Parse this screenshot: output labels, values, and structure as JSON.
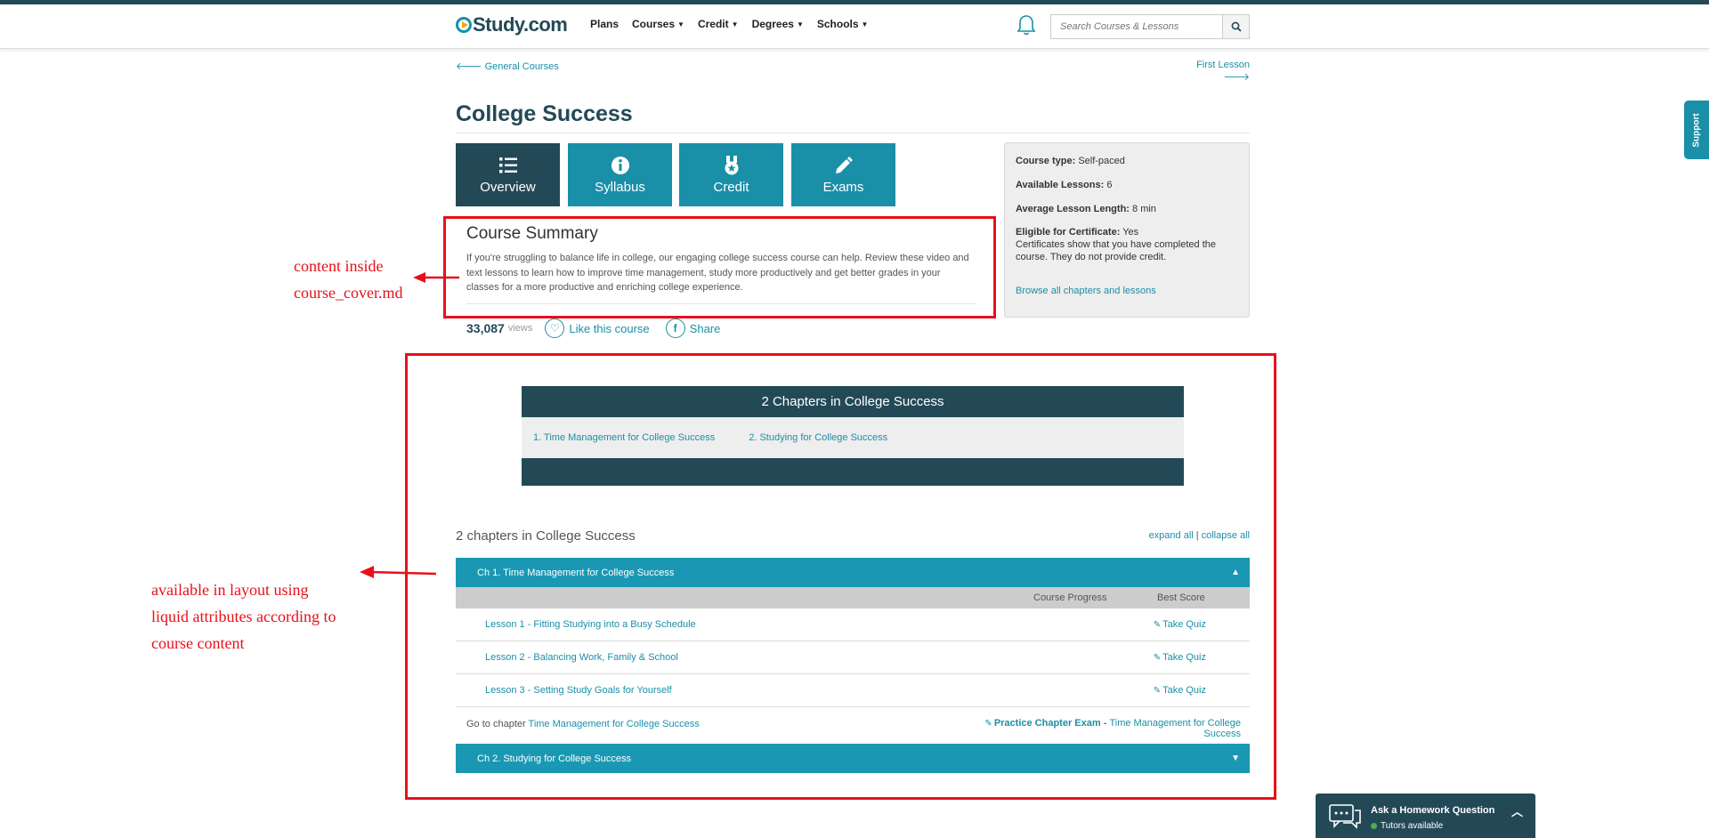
{
  "header": {
    "logo": "Study.com",
    "nav": [
      {
        "label": "Plans",
        "dropdown": false
      },
      {
        "label": "Courses",
        "dropdown": true
      },
      {
        "label": "Credit",
        "dropdown": true
      },
      {
        "label": "Degrees",
        "dropdown": true
      },
      {
        "label": "Schools",
        "dropdown": true
      }
    ],
    "search_placeholder": "Search Courses & Lessons"
  },
  "support_label": "Support",
  "breadcrumb": {
    "back": "General Courses",
    "next": "First Lesson"
  },
  "page_title": "College Success",
  "tabs": [
    {
      "label": "Overview",
      "icon": "list-icon",
      "active": true
    },
    {
      "label": "Syllabus",
      "icon": "info-icon",
      "active": false
    },
    {
      "label": "Credit",
      "icon": "medal-icon",
      "active": false
    },
    {
      "label": "Exams",
      "icon": "pencil-icon",
      "active": false
    }
  ],
  "info": {
    "course_type_label": "Course type:",
    "course_type_value": "Self-paced",
    "lessons_label": "Available Lessons:",
    "lessons_value": "6",
    "length_label": "Average Lesson Length:",
    "length_value": "8 min",
    "certificate_label": "Eligible for Certificate:",
    "certificate_value": "Yes",
    "certificate_note": "Certificates show that you have completed the course. They do not provide credit.",
    "browse_link": "Browse all chapters and lessons"
  },
  "summary": {
    "heading": "Course Summary",
    "text": "If you're struggling to balance life in college, our engaging college success course can help. Review these video and text lessons to learn how to improve time management, study more productively and get better grades in your classes for a more productive and enriching college experience."
  },
  "stats": {
    "views_count": "33,087",
    "views_label": "views",
    "like_label": "Like this course",
    "share_label": "Share"
  },
  "annotations": {
    "note1_line1": "content inside",
    "note1_line2": "course_cover.md",
    "note2_line1": "available in layout using",
    "note2_line2": "liquid attributes according to",
    "note2_line3": "course content"
  },
  "chapter_nav": {
    "heading": "2 Chapters in College Success",
    "links": [
      "1. Time Management for College Success",
      "2. Studying for College Success"
    ]
  },
  "chapters_section": {
    "title": "2 chapters in College Success",
    "expand_all": "expand all",
    "separator": "|",
    "collapse_all": "collapse all"
  },
  "chapter1": {
    "title": "Ch 1. Time Management for College Success",
    "col_progress": "Course Progress",
    "col_score": "Best Score",
    "lessons": [
      {
        "name": "Lesson 1 - Fitting Studying into a Busy Schedule",
        "action": "Take Quiz"
      },
      {
        "name": "Lesson 2 - Balancing Work, Family & School",
        "action": "Take Quiz"
      },
      {
        "name": "Lesson 3 - Setting Study Goals for Yourself",
        "action": "Take Quiz"
      }
    ],
    "goto_prefix": "Go to chapter",
    "goto_link": "Time Management for College Success",
    "practice_bold": "Practice Chapter Exam",
    "practice_sep": " - ",
    "practice_link": "Time Management for College Success"
  },
  "chapter2": {
    "title": "Ch 2. Studying for College Success"
  },
  "homework": {
    "title": "Ask a Homework Question",
    "status": "Tutors available"
  },
  "colors": {
    "brand_dark": "#234957",
    "brand_teal": "#1a8fa8",
    "annotation_red": "#e8101a"
  }
}
